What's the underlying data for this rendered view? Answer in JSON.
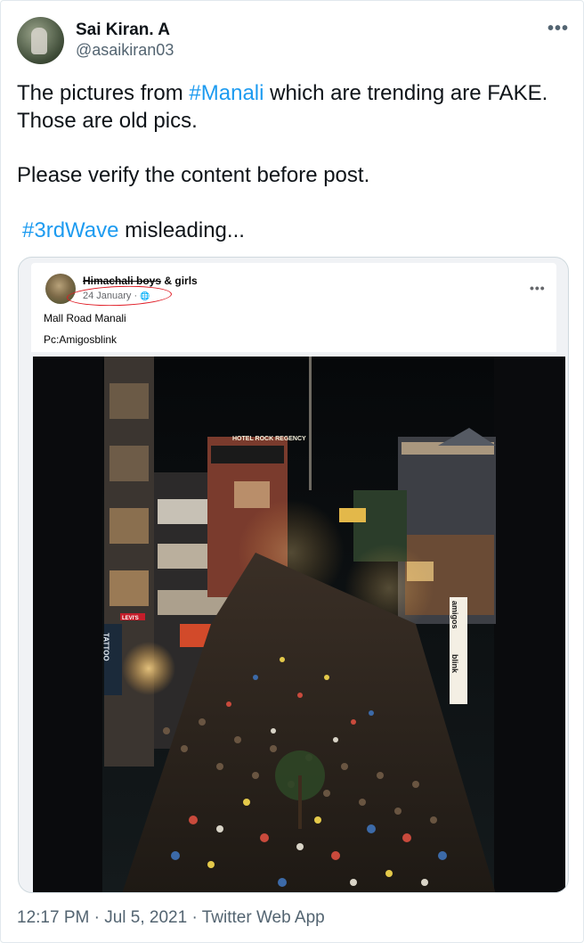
{
  "author": {
    "display_name": "Sai Kiran. A",
    "handle": "@asaikiran03"
  },
  "more_glyph": "•••",
  "tweet": {
    "line1_prefix": "The pictures from ",
    "line1_hashtag": "#Manali",
    "line1_suffix": " which are trending are FAKE. Those are old pics.",
    "line2": "Please verify the content before post.",
    "line3_hashtag": "#3rdWave",
    "line3_suffix": " misleading..."
  },
  "embedded_post": {
    "page_name_struck": "Himachali boys",
    "page_name_rest": " & girls",
    "date": "24 January · ",
    "globe_glyph": "🌐",
    "more_glyph": "•••",
    "caption_line1": "Mall Road Manali",
    "caption_line2": "Pc:Amigosblink",
    "photo_signs": {
      "hotel": "HOTEL ROCK REGENCY",
      "tattoo": "TATTOO",
      "amigos": "amigos",
      "blink": "blink",
      "levis": "LEVI'S"
    }
  },
  "footer": "12:17 PM · Jul 5, 2021 · Twitter Web App",
  "colors": {
    "accent": "#1d9bf0",
    "secondary_text": "#536471",
    "annotation_red": "#e01b24"
  }
}
